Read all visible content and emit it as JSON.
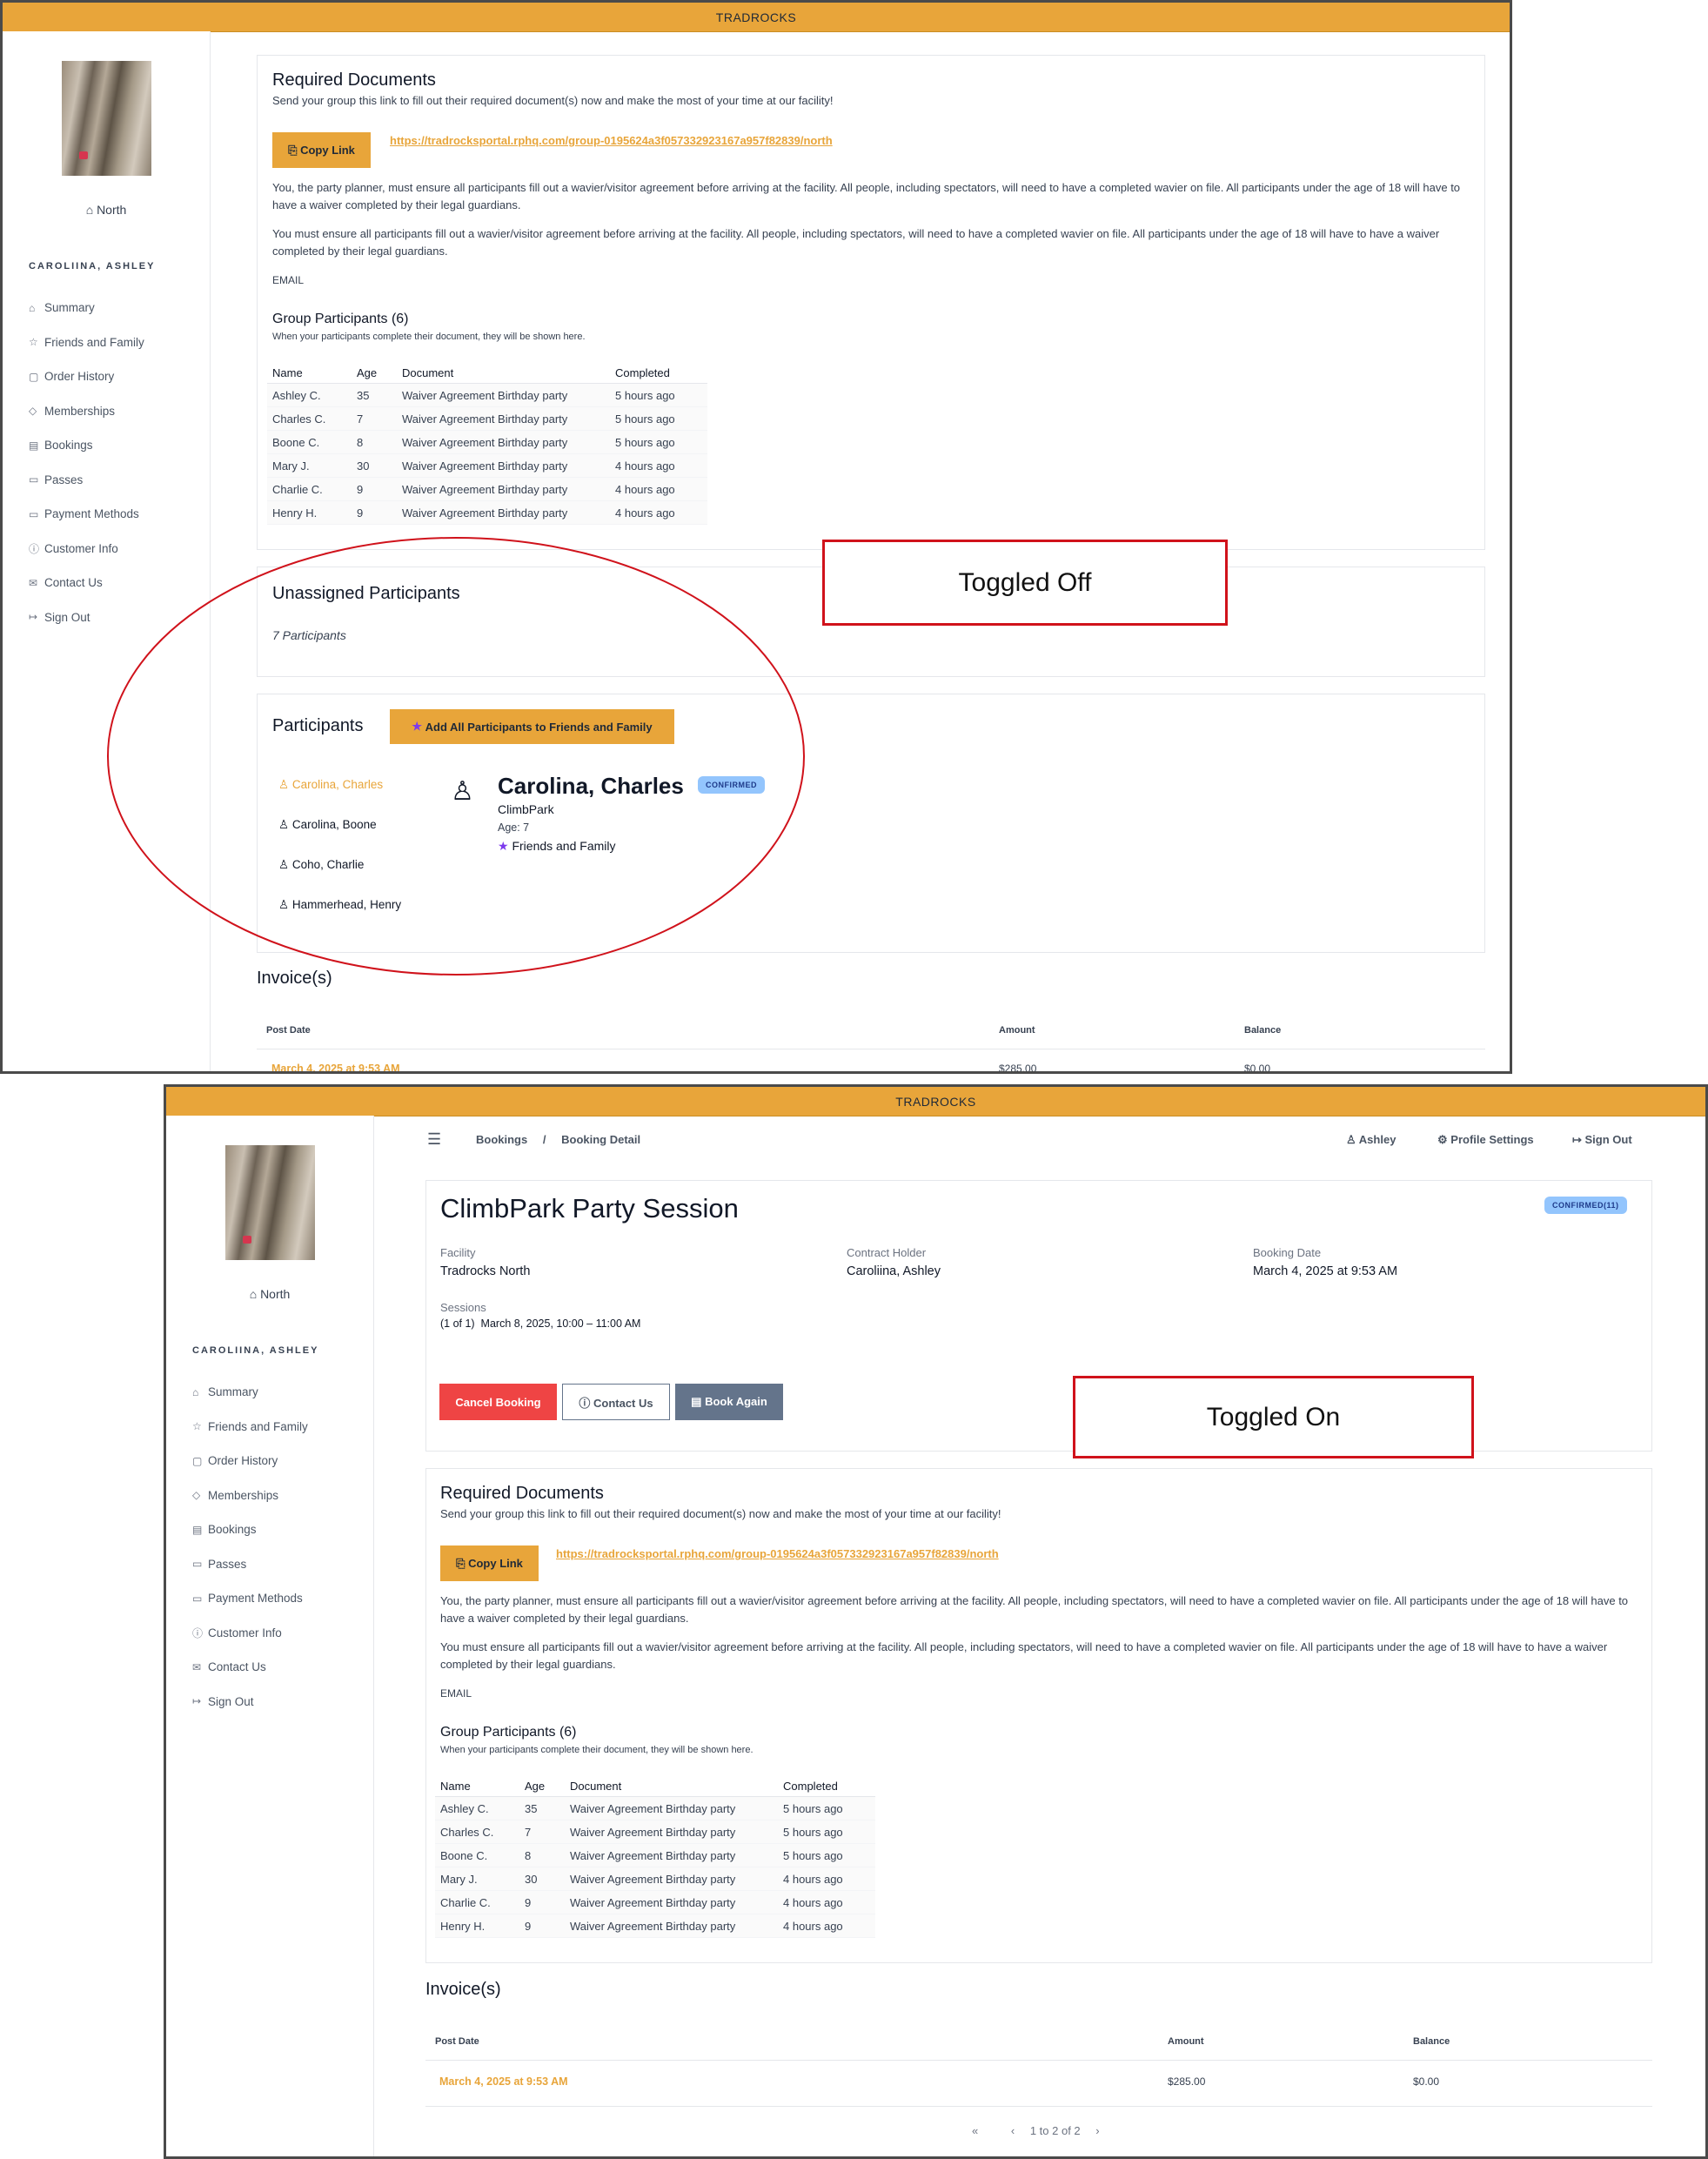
{
  "app": {
    "title": "TRADROCKS"
  },
  "sidebar": {
    "location": "North",
    "user": "CAROLIINA, ASHLEY",
    "items": [
      {
        "label": "Summary",
        "icon": "home-icon"
      },
      {
        "label": "Friends and Family",
        "icon": "star-icon"
      },
      {
        "label": "Order History",
        "icon": "bag-icon"
      },
      {
        "label": "Memberships",
        "icon": "tag-icon"
      },
      {
        "label": "Bookings",
        "icon": "calendar-icon"
      },
      {
        "label": "Passes",
        "icon": "ticket-icon"
      },
      {
        "label": "Payment Methods",
        "icon": "card-icon"
      },
      {
        "label": "Customer Info",
        "icon": "info-icon"
      },
      {
        "label": "Contact Us",
        "icon": "mail-icon"
      },
      {
        "label": "Sign Out",
        "icon": "signout-icon"
      }
    ]
  },
  "header": {
    "breadcrumb": [
      "Bookings",
      "Booking Detail"
    ],
    "separator": "/",
    "user_label": "Ashley",
    "profile_label": "Profile Settings",
    "signout_label": "Sign Out"
  },
  "booking": {
    "title": "ClimbPark Party Session",
    "status": "CONFIRMED(11)",
    "facility_label": "Facility",
    "facility": "Tradrocks North",
    "holder_label": "Contract Holder",
    "holder": "Caroliina, Ashley",
    "date_label": "Booking Date",
    "date": "March 4, 2025 at 9:53 AM",
    "sessions_label": "Sessions",
    "sessions": "(1 of 1)  March 8, 2025, 10:00 – 11:00 AM",
    "cancel_label": "Cancel Booking",
    "contact_label": "Contact Us",
    "book_again_label": "Book Again"
  },
  "documents": {
    "title": "Required Documents",
    "subtitle": "Send your group this link to fill out their required document(s) now and make the most of your time at our facility!",
    "copy_label": "Copy Link",
    "link": "https://tradrocksportal.rphq.com/group-0195624a3f057332923167a957f82839/north",
    "para1": "You, the party planner, must ensure all participants fill out a wavier/visitor agreement before arriving at the facility. All people, including spectators, will need to have a completed wavier on file. All participants under the age of 18 will have to have a waiver completed by their legal guardians.",
    "para2": "You  must ensure all participants fill out a wavier/visitor agreement before arriving at the facility. All people, including spectators, will need to have a completed wavier on file. All participants under the age of 18 will have to have a waiver completed by their legal guardians.",
    "email_label": "EMAIL",
    "group_title": "Group Participants (6)",
    "group_sub": "When your participants complete their document, they will be shown here.",
    "columns": [
      "Name",
      "Age",
      "Document",
      "Completed"
    ],
    "rows": [
      [
        "Ashley C.",
        "35",
        "Waiver Agreement Birthday party",
        "5 hours ago"
      ],
      [
        "Charles C.",
        "7",
        "Waiver Agreement Birthday party",
        "5 hours ago"
      ],
      [
        "Boone C.",
        "8",
        "Waiver Agreement Birthday party",
        "5 hours ago"
      ],
      [
        "Mary J.",
        "30",
        "Waiver Agreement Birthday party",
        "4 hours ago"
      ],
      [
        "Charlie C.",
        "9",
        "Waiver Agreement Birthday party",
        "4 hours ago"
      ],
      [
        "Henry H.",
        "9",
        "Waiver Agreement Birthday party",
        "4 hours ago"
      ]
    ]
  },
  "unassigned": {
    "title": "Unassigned Participants",
    "count": "7 Participants"
  },
  "participants": {
    "title": "Participants",
    "add_all_label": "Add All Participants to Friends and Family",
    "list": [
      "Carolina, Charles",
      "Carolina, Boone",
      "Coho, Charlie",
      "Hammerhead, Henry"
    ],
    "selected": {
      "name": "Carolina, Charles",
      "status": "CONFIRMED",
      "org": "ClimbPark",
      "age": "Age: 7",
      "tag": "Friends and Family"
    }
  },
  "invoices": {
    "title": "Invoice(s)",
    "columns": [
      "Post Date",
      "Amount",
      "Balance"
    ],
    "row": {
      "date": "March 4, 2025 at 9:53 AM",
      "amount": "$285.00",
      "balance": "$0.00"
    },
    "pagination": "1 to 2 of 2"
  },
  "annotations": {
    "off": "Toggled Off",
    "on": "Toggled On"
  },
  "colors": {
    "brand": "#e8a53a",
    "danger": "#ef4444",
    "slate": "#64748b",
    "badge": "#93c5fd",
    "annotation": "#d0121b"
  }
}
